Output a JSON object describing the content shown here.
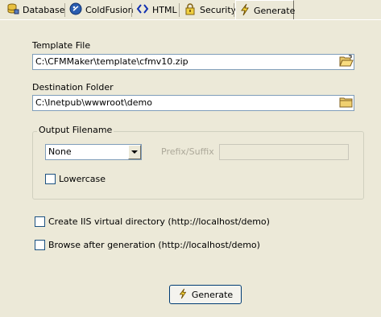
{
  "tabs": [
    {
      "label": "Database",
      "icon": "database-icon"
    },
    {
      "label": "ColdFusion",
      "icon": "coldfusion-icon"
    },
    {
      "label": "HTML",
      "icon": "html-icon"
    },
    {
      "label": "Security",
      "icon": "lock-icon"
    },
    {
      "label": "Generate",
      "icon": "lightning-icon",
      "active": true
    }
  ],
  "template_file": {
    "label": "Template File",
    "value": "C:\\CFMMaker\\template\\cfmv10.zip"
  },
  "destination_folder": {
    "label": "Destination Folder",
    "value": "C:\\Inetpub\\wwwroot\\demo"
  },
  "output_filename": {
    "group_title": "Output Filename",
    "case_selected": "None",
    "prefix_suffix_label": "Prefix/Suffix",
    "prefix_suffix_value": "",
    "lowercase_label": "Lowercase",
    "lowercase_checked": false
  },
  "options": {
    "create_iis_label": "Create IIS virtual directory (http://localhost/demo)",
    "create_iis_checked": false,
    "browse_after_label": "Browse after generation (http://localhost/demo)",
    "browse_after_checked": false
  },
  "generate_button": {
    "label": "Generate",
    "icon": "lightning-icon"
  },
  "colors": {
    "window_bg": "#ece9d8",
    "input_border": "#7f9db9",
    "button_border": "#003c74"
  }
}
